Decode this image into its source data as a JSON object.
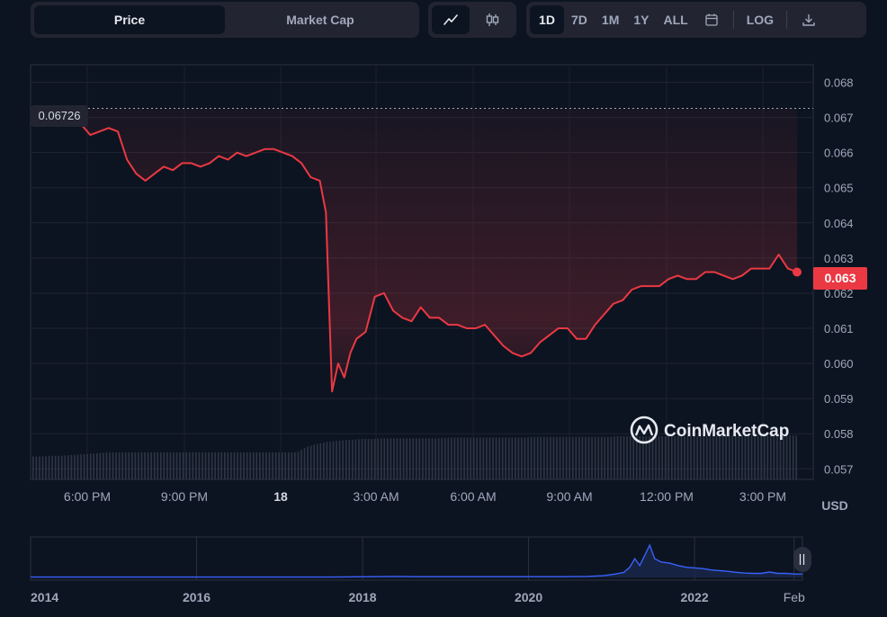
{
  "toolbar": {
    "type_tabs": [
      "Price",
      "Market Cap"
    ],
    "range_tabs": [
      "1D",
      "7D",
      "1M",
      "1Y",
      "ALL"
    ],
    "log_label": "LOG"
  },
  "watermark": "CoinMarketCap",
  "chart_data": [
    {
      "type": "area",
      "title": "",
      "currency": "USD",
      "ylim": [
        0.0567,
        0.0685
      ],
      "y_ticks": [
        "0.068",
        "0.067",
        "0.066",
        "0.065",
        "0.064",
        "0.063",
        "0.062",
        "0.061",
        "0.060",
        "0.059",
        "0.058",
        "0.057"
      ],
      "x_ticks": [
        "6:00 PM",
        "9:00 PM",
        "18",
        "3:00 AM",
        "6:00 AM",
        "9:00 AM",
        "12:00 PM",
        "3:00 PM"
      ],
      "open_price_label": "0.06726",
      "current_price_label": "0.063",
      "line_color": "#ea3943",
      "series": [
        {
          "x_hours": [
            0,
            0.3,
            0.6,
            0.9,
            1.2,
            1.5,
            1.8,
            2.1,
            2.4,
            2.7,
            3.0,
            3.3,
            3.6,
            3.9,
            4.2,
            4.5,
            4.8,
            5.1,
            5.4,
            5.7,
            6.0,
            6.3,
            6.6,
            6.9,
            7.2,
            7.5,
            7.8,
            8.1,
            8.3,
            8.5,
            8.7,
            8.9,
            9.1,
            9.3,
            9.6,
            9.9,
            10.2,
            10.5,
            10.8,
            11.1,
            11.4,
            11.7,
            12.0,
            12.3,
            12.6,
            12.9,
            13.2,
            13.5,
            13.8,
            14.1,
            14.4,
            14.7,
            15.0,
            15.3,
            15.6,
            15.9,
            16.2,
            16.5,
            16.8,
            17.1,
            17.4,
            17.7,
            18.0,
            18.3,
            18.6,
            18.9,
            19.2,
            19.5,
            19.8,
            20.1,
            20.4,
            20.7,
            21.0,
            21.3,
            21.6,
            21.9,
            22.2,
            22.5,
            22.8,
            23.1,
            23.4,
            23.7
          ],
          "values": [
            0.06725,
            0.0668,
            0.0665,
            0.0666,
            0.0667,
            0.0666,
            0.0658,
            0.0654,
            0.0652,
            0.0654,
            0.0656,
            0.0655,
            0.0657,
            0.0657,
            0.0656,
            0.0657,
            0.0659,
            0.0658,
            0.066,
            0.0659,
            0.066,
            0.0661,
            0.0661,
            0.066,
            0.0659,
            0.0657,
            0.0653,
            0.0652,
            0.0643,
            0.0592,
            0.06,
            0.0596,
            0.0603,
            0.0607,
            0.0609,
            0.0619,
            0.062,
            0.0615,
            0.0613,
            0.0612,
            0.0616,
            0.0613,
            0.0613,
            0.0611,
            0.0611,
            0.061,
            0.061,
            0.0611,
            0.0608,
            0.0605,
            0.0603,
            0.0602,
            0.0603,
            0.0606,
            0.0608,
            0.061,
            0.061,
            0.0607,
            0.0607,
            0.0611,
            0.0614,
            0.0617,
            0.0618,
            0.0621,
            0.0622,
            0.0622,
            0.0622,
            0.0624,
            0.0625,
            0.0624,
            0.0624,
            0.0626,
            0.0626,
            0.0625,
            0.0624,
            0.0625,
            0.0627,
            0.0627,
            0.0627,
            0.0631,
            0.0627,
            0.0626
          ]
        }
      ],
      "volume_relative": [
        0.34,
        0.34,
        0.35,
        0.35,
        0.36,
        0.37,
        0.38,
        0.39,
        0.4,
        0.4,
        0.4,
        0.4,
        0.4,
        0.4,
        0.4,
        0.4,
        0.4,
        0.4,
        0.4,
        0.4,
        0.4,
        0.4,
        0.4,
        0.4,
        0.4,
        0.4,
        0.4,
        0.4,
        0.4,
        0.48,
        0.52,
        0.55,
        0.57,
        0.58,
        0.59,
        0.6,
        0.6,
        0.61,
        0.61,
        0.61,
        0.61,
        0.61,
        0.61,
        0.61,
        0.62,
        0.62,
        0.62,
        0.62,
        0.62,
        0.62,
        0.62,
        0.62,
        0.62,
        0.63,
        0.63,
        0.63,
        0.63,
        0.63,
        0.63,
        0.63,
        0.63,
        0.63,
        0.64,
        0.64,
        0.64,
        0.64,
        0.64,
        0.64,
        0.64,
        0.64,
        0.64,
        0.64,
        0.64,
        0.64,
        0.65,
        0.65,
        0.65,
        0.65,
        0.65,
        0.65,
        0.65,
        0.65
      ]
    },
    {
      "type": "line",
      "title": "",
      "x_ticks": [
        "2014",
        "2016",
        "2018",
        "2020",
        "2022",
        "Feb"
      ],
      "x_years": [
        2013.9,
        2015.9,
        2017.9,
        2019.9,
        2021.9,
        2023.1
      ],
      "values_relative": [
        0.01,
        0.01,
        0.01,
        0.01,
        0.01,
        0.01,
        0.01,
        0.01,
        0.02,
        0.03,
        0.02,
        0.02,
        0.02,
        0.02,
        0.02,
        0.03,
        0.05,
        0.1,
        0.15,
        0.3,
        0.55,
        0.35,
        0.65,
        0.95,
        0.55,
        0.45,
        0.42,
        0.35,
        0.3,
        0.28,
        0.26,
        0.22,
        0.2,
        0.18,
        0.15,
        0.13,
        0.12,
        0.12,
        0.16,
        0.12,
        0.12,
        0.1,
        0.1
      ],
      "x_years_series": [
        2013.9,
        2014.5,
        2015.0,
        2015.5,
        2016.0,
        2016.5,
        2017.0,
        2017.5,
        2018.0,
        2018.3,
        2018.6,
        2019.0,
        2019.5,
        2020.0,
        2020.3,
        2020.6,
        2020.8,
        2020.95,
        2021.05,
        2021.12,
        2021.18,
        2021.24,
        2021.3,
        2021.36,
        2021.42,
        2021.5,
        2021.6,
        2021.7,
        2021.8,
        2021.9,
        2022.0,
        2022.1,
        2022.2,
        2022.3,
        2022.4,
        2022.5,
        2022.6,
        2022.7,
        2022.8,
        2022.9,
        2023.0,
        2023.1,
        2023.2
      ]
    }
  ]
}
